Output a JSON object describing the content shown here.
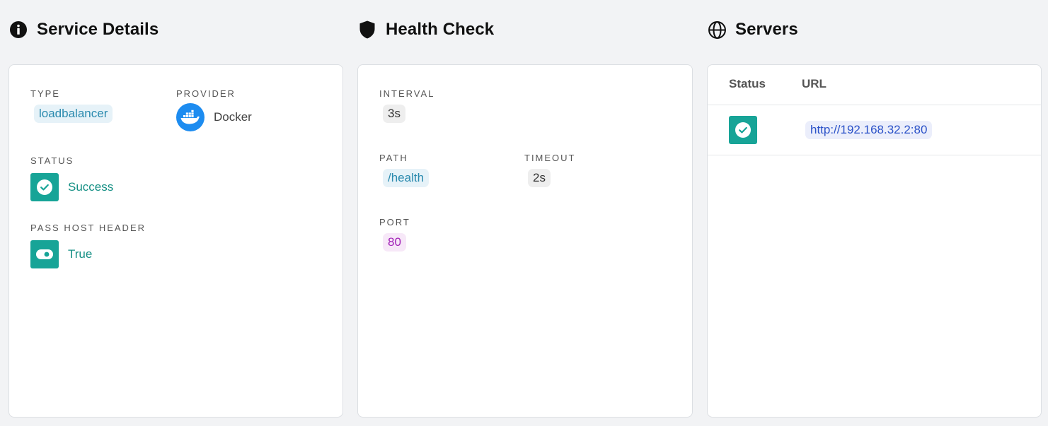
{
  "service_details": {
    "title": "Service Details",
    "icon": "info-icon",
    "type_label": "TYPE",
    "type_value": "loadbalancer",
    "provider_label": "PROVIDER",
    "provider_value": "Docker",
    "provider_icon": "docker-icon",
    "status_label": "STATUS",
    "status_value": "Success",
    "pass_host_header_label": "PASS HOST HEADER",
    "pass_host_header_value": "True"
  },
  "health_check": {
    "title": "Health Check",
    "icon": "shield-icon",
    "interval_label": "INTERVAL",
    "interval_value": "3s",
    "path_label": "PATH",
    "path_value": "/health",
    "timeout_label": "TIMEOUT",
    "timeout_value": "2s",
    "port_label": "PORT",
    "port_value": "80"
  },
  "servers": {
    "title": "Servers",
    "icon": "globe-icon",
    "columns": [
      "Status",
      "URL"
    ],
    "rows": [
      {
        "status": "success",
        "url": "http://192.168.32.2:80"
      }
    ]
  },
  "colors": {
    "background": "#f2f3f5",
    "success": "#17a497",
    "docker_blue": "#1d8cf0",
    "chip_blue_text": "#2a8aae",
    "chip_purple_text": "#a020b6",
    "link": "#2b52c8"
  }
}
